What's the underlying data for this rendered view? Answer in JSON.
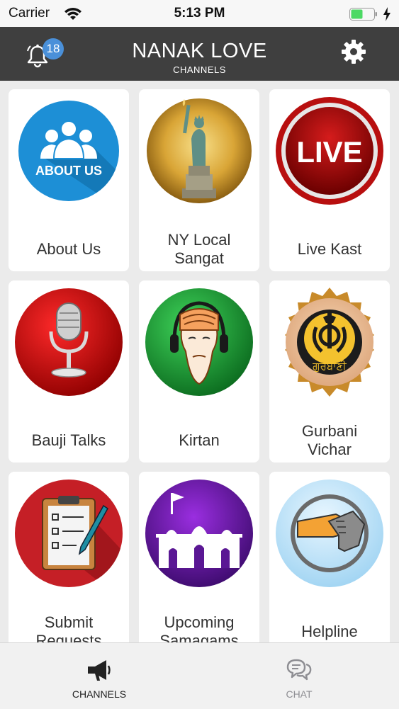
{
  "status_bar": {
    "carrier": "Carrier",
    "time": "5:13 PM"
  },
  "header": {
    "title": "NANAK LOVE",
    "subtitle": "CHANNELS",
    "notification_count": "18"
  },
  "tiles": [
    {
      "label": "About Us",
      "icon_text": "ABOUT US"
    },
    {
      "label": "NY Local\nSangat"
    },
    {
      "label": "Live Kast",
      "icon_text": "LIVE"
    },
    {
      "label": "Bauji Talks"
    },
    {
      "label": "Kirtan"
    },
    {
      "label": "Gurbani\nVichar",
      "icon_text": "ਗੁਰਬਾਣੀ"
    },
    {
      "label": "Submit\nRequests"
    },
    {
      "label": "Upcoming\nSamagams"
    },
    {
      "label": "Helpline"
    }
  ],
  "tab_bar": {
    "tabs": [
      {
        "label": "CHANNELS",
        "active": true
      },
      {
        "label": "CHAT",
        "active": false
      }
    ]
  },
  "colors": {
    "header_bg": "#3f3f3f",
    "badge": "#4a90d9",
    "battery": "#4cd964",
    "tab_active": "#222222",
    "tab_inactive": "#8e8e93"
  }
}
